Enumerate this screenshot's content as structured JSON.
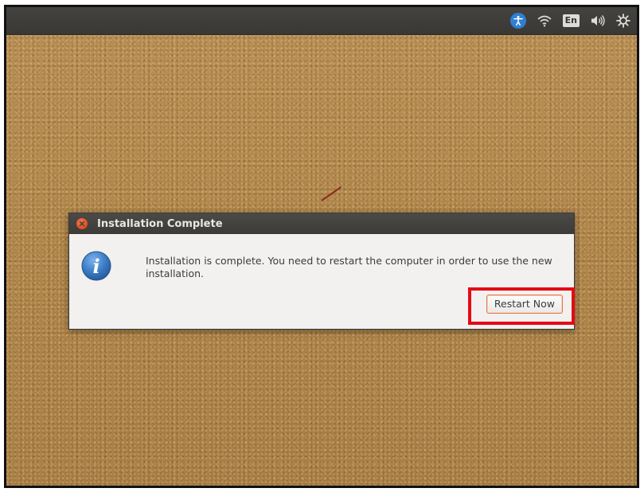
{
  "topbar": {
    "icons": [
      "accessibility-icon",
      "wifi-icon",
      "keyboard-language-icon",
      "volume-icon",
      "settings-gear-icon"
    ],
    "language_label": "En"
  },
  "dialog": {
    "title": "Installation Complete",
    "message": "Installation is complete. You need to restart the computer in order to use the new installation.",
    "restart_button_label": "Restart Now",
    "icons": [
      "close-icon",
      "info-icon"
    ]
  },
  "colors": {
    "panel": "#3c3b37",
    "dialog_background": "#f2f1f0",
    "close_button": "#df4b1d",
    "highlight": "#e50914",
    "desktop_sand": "#b38a4f",
    "info_blue": "#2f6fb5"
  }
}
